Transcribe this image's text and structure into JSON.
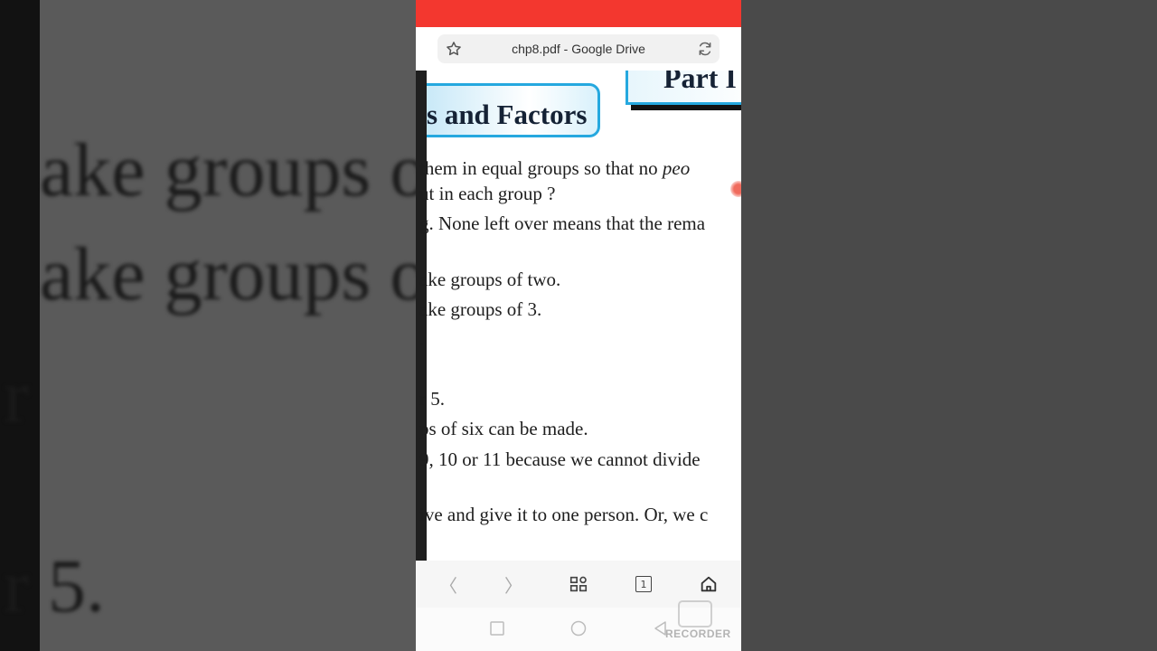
{
  "background": {
    "lines": [
      "ake groups of",
      "ake groups of",
      "r",
      "r 5."
    ]
  },
  "browser": {
    "tab_title": "chp8.pdf - Google Drive",
    "bookmark_icon": "star-icon",
    "reload_icon": "reload-icon"
  },
  "pdf": {
    "part_label": "Part I",
    "heading": "s and Factors",
    "lines": [
      "them in equal groups so that no ",
      "peo",
      "ut in each group ?",
      "g. None left over means that the rema",
      "ake groups of two.",
      "ake groups of 3.",
      ".",
      "r 5.",
      "ps of six can be made.",
      "9, 10 or 11 because we cannot divide",
      "ive and give it to one person. Or, we c"
    ]
  },
  "nav": {
    "back": "〈",
    "forward": "〉",
    "tabs_count": "1"
  },
  "watermark": {
    "text": "RECORDER"
  },
  "colors": {
    "status_bar": "#f3372f",
    "accent_blue": "#25a8df"
  }
}
